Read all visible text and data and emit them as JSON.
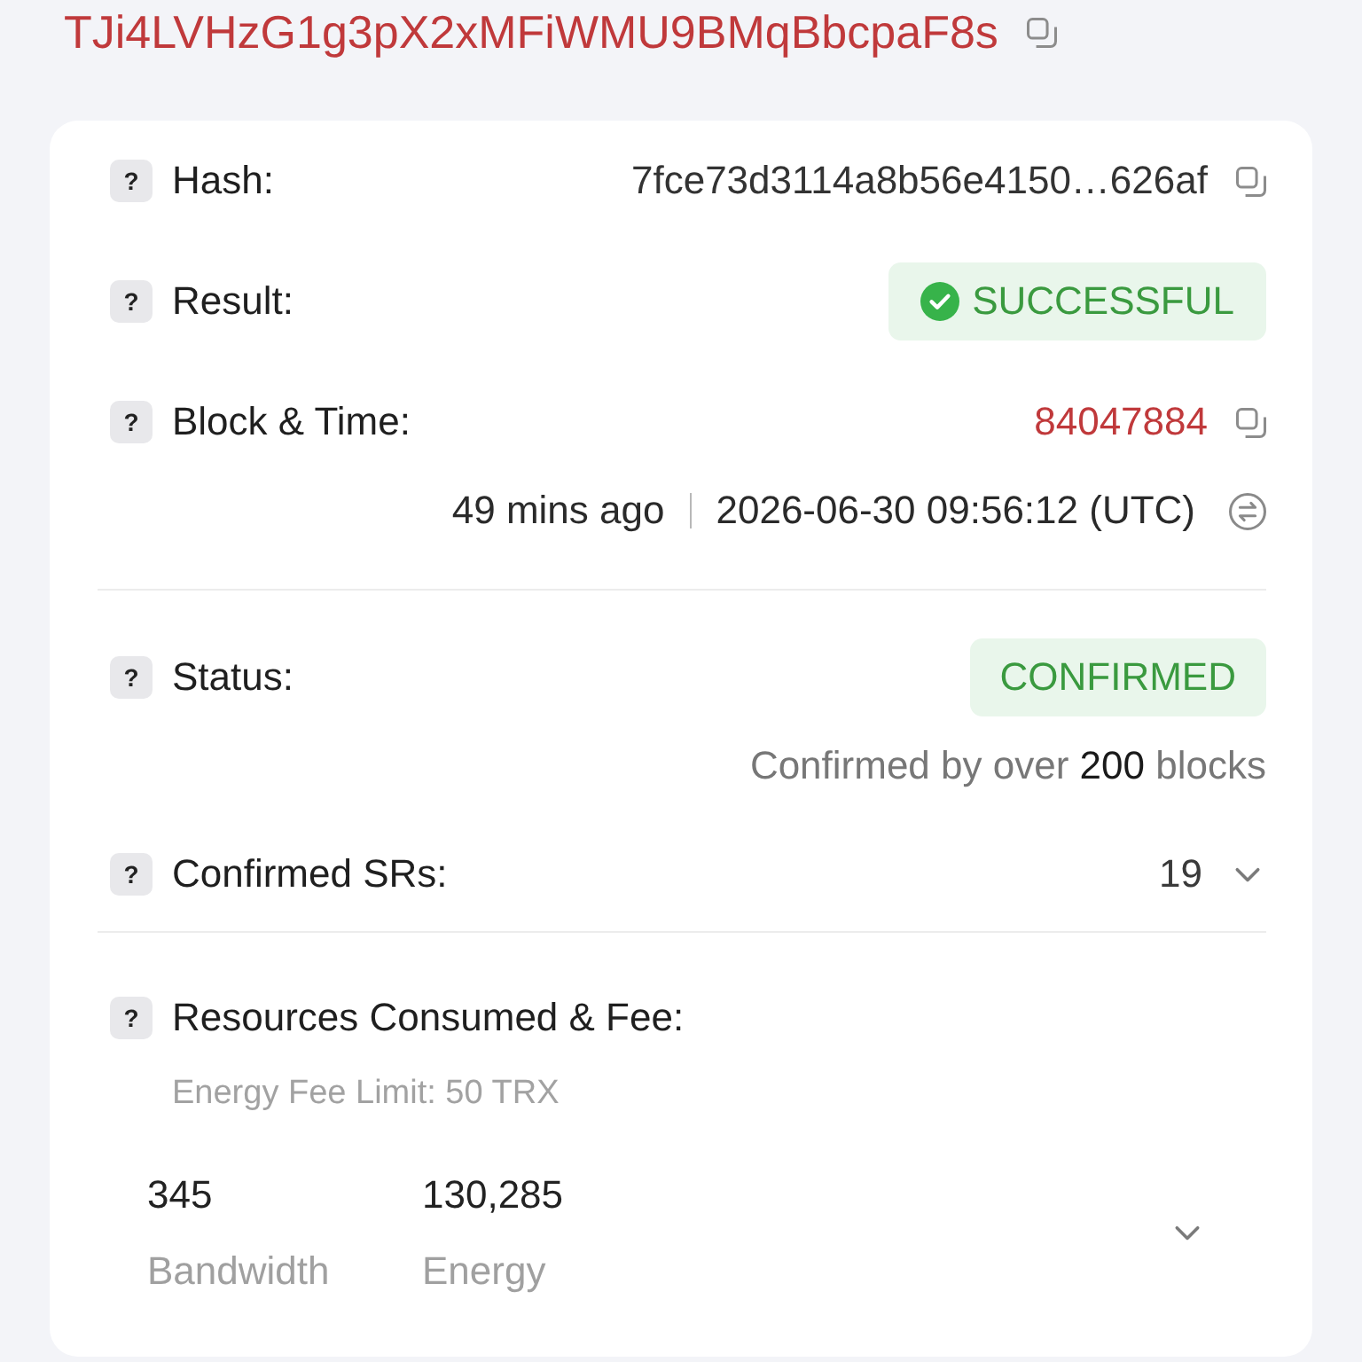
{
  "address": "TJi4LVHzG1g3pX2xMFiWMU9BMqBbcpaF8s",
  "sections": [
    {
      "rows": [
        {
          "kind": "hash",
          "help": "?",
          "label": "Hash:",
          "value": "7fce73d3114a8b56e4150…626af"
        },
        {
          "kind": "result",
          "help": "?",
          "label": "Result:",
          "value": "SUCCESSFUL"
        },
        {
          "kind": "block",
          "help": "?",
          "label": "Block & Time:",
          "value": "84047884",
          "age": "49 mins ago",
          "timestamp": "2026-06-30 09:56:12 (UTC)"
        }
      ]
    },
    {
      "rows": [
        {
          "kind": "status",
          "help": "?",
          "label": "Status:",
          "value": "CONFIRMED",
          "note": "Confirmed by over **200** blocks"
        },
        {
          "kind": "srs",
          "help": "?",
          "label": "Confirmed SRs:",
          "value": "19",
          "expanded": false
        }
      ]
    },
    {
      "rows": [
        {
          "kind": "resources",
          "help": "?",
          "label": "Resources Consumed & Fee:",
          "note": "Energy Fee Limit: 50 TRX",
          "resources": [
            {
              "amount": "345",
              "name": "Bandwidth"
            },
            {
              "amount": "130,285",
              "name": "Energy"
            }
          ],
          "expanded": false
        }
      ]
    }
  ]
}
